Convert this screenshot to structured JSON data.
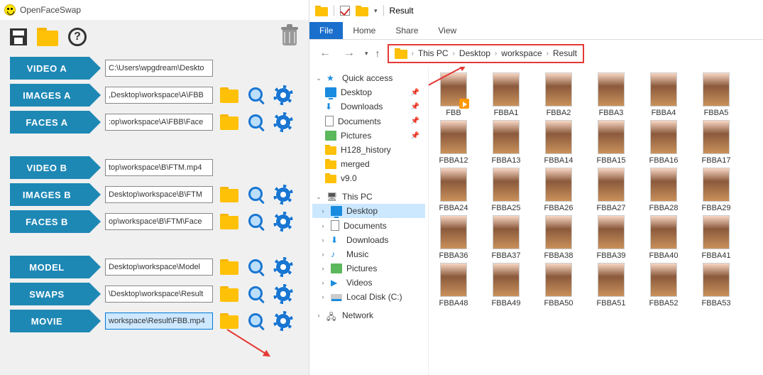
{
  "app": {
    "title": "OpenFaceSwap"
  },
  "rows": {
    "video_a": {
      "label": "VIDEO A",
      "value": "C:\\Users\\wpgdream\\Deskto"
    },
    "images_a": {
      "label": "IMAGES A",
      "value": ",Desktop\\workspace\\A\\FBB"
    },
    "faces_a": {
      "label": "FACES A",
      "value": ":op\\workspace\\A\\FBB\\Face"
    },
    "video_b": {
      "label": "VIDEO B",
      "value": "top\\workspace\\B\\FTM.mp4"
    },
    "images_b": {
      "label": "IMAGES B",
      "value": "Desktop\\workspace\\B\\FTM"
    },
    "faces_b": {
      "label": "FACES B",
      "value": "op\\workspace\\B\\FTM\\Face"
    },
    "model": {
      "label": "MODEL",
      "value": "Desktop\\workspace\\Model"
    },
    "swaps": {
      "label": "SWAPS",
      "value": "\\Desktop\\workspace\\Result"
    },
    "movie": {
      "label": "MOVIE",
      "value": "workspace\\Result\\FBB.mp4"
    }
  },
  "explorer": {
    "title": "Result",
    "tabs": {
      "file": "File",
      "home": "Home",
      "share": "Share",
      "view": "View"
    },
    "crumbs": [
      "This PC",
      "Desktop",
      "workspace",
      "Result"
    ],
    "tree": {
      "quick_access": "Quick access",
      "desktop": "Desktop",
      "downloads": "Downloads",
      "documents": "Documents",
      "pictures": "Pictures",
      "h128": "H128_history",
      "merged": "merged",
      "v90": "v9.0",
      "this_pc": "This PC",
      "pc_desktop": "Desktop",
      "pc_documents": "Documents",
      "pc_downloads": "Downloads",
      "pc_music": "Music",
      "pc_pictures": "Pictures",
      "pc_videos": "Videos",
      "local_disk": "Local Disk (C:)",
      "network": "Network"
    },
    "files": [
      "FBB",
      "FBBA1",
      "FBBA2",
      "FBBA3",
      "FBBA4",
      "FBBA5",
      "FBBA12",
      "FBBA13",
      "FBBA14",
      "FBBA15",
      "FBBA16",
      "FBBA17",
      "FBBA24",
      "FBBA25",
      "FBBA26",
      "FBBA27",
      "FBBA28",
      "FBBA29",
      "FBBA36",
      "FBBA37",
      "FBBA38",
      "FBBA39",
      "FBBA40",
      "FBBA41",
      "FBBA48",
      "FBBA49",
      "FBBA50",
      "FBBA51",
      "FBBA52",
      "FBBA53"
    ]
  }
}
